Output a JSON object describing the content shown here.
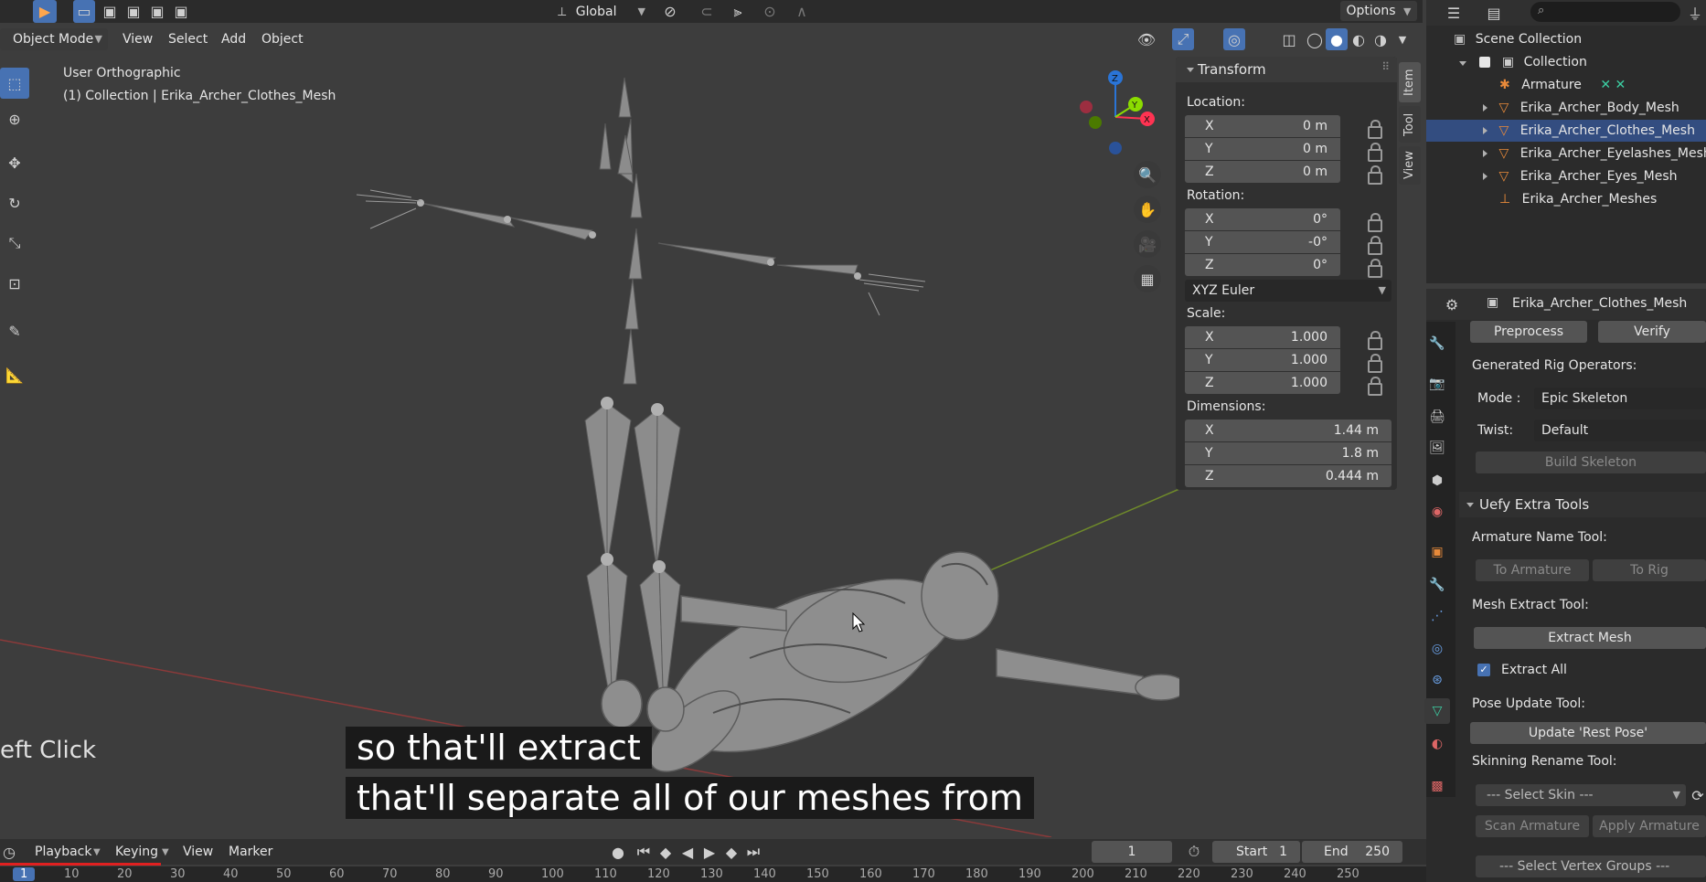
{
  "topbar": {
    "transform_orientation": "Global",
    "options_label": "Options"
  },
  "viewport_header": {
    "mode": "Object Mode",
    "menus": [
      "View",
      "Select",
      "Add",
      "Object"
    ]
  },
  "viewport": {
    "view_name": "User Orthographic",
    "object_info": "(1) Collection | Erika_Archer_Clothes_Mesh",
    "hint_text": "eft Click",
    "gizmo_axes": [
      "Z",
      "Y",
      "X"
    ]
  },
  "transform_panel": {
    "title": "Transform",
    "location_label": "Location:",
    "location": [
      {
        "axis": "X",
        "value": "0 m"
      },
      {
        "axis": "Y",
        "value": "0 m"
      },
      {
        "axis": "Z",
        "value": "0 m"
      }
    ],
    "rotation_label": "Rotation:",
    "rotation": [
      {
        "axis": "X",
        "value": "0°"
      },
      {
        "axis": "Y",
        "value": "-0°"
      },
      {
        "axis": "Z",
        "value": "0°"
      }
    ],
    "rotation_mode": "XYZ Euler",
    "scale_label": "Scale:",
    "scale": [
      {
        "axis": "X",
        "value": "1.000"
      },
      {
        "axis": "Y",
        "value": "1.000"
      },
      {
        "axis": "Z",
        "value": "1.000"
      }
    ],
    "dimensions_label": "Dimensions:",
    "dimensions": [
      {
        "axis": "X",
        "value": "1.44 m"
      },
      {
        "axis": "Y",
        "value": "1.8 m"
      },
      {
        "axis": "Z",
        "value": "0.444 m"
      }
    ]
  },
  "npanel_tabs": [
    "Item",
    "Tool",
    "View"
  ],
  "outliner": {
    "scene_collection": "Scene Collection",
    "collection": "Collection",
    "items": [
      "Armature",
      "Erika_Archer_Body_Mesh",
      "Erika_Archer_Clothes_Mesh",
      "Erika_Archer_Eyelashes_Mesh",
      "Erika_Archer_Eyes_Mesh",
      "Erika_Archer_Meshes"
    ]
  },
  "properties": {
    "object_name": "Erika_Archer_Clothes_Mesh",
    "preprocess_label": "Preprocess",
    "verify_label": "Verify",
    "generated_rig_label": "Generated Rig Operators:",
    "mode_label": "Mode :",
    "mode_value": "Epic Skeleton",
    "twist_label": "Twist:",
    "twist_value": "Default",
    "build_skeleton_label": "Build Skeleton",
    "extra_tools_title": "Uefy Extra Tools",
    "armature_name_tool_label": "Armature Name Tool:",
    "to_armature_label": "To Armature",
    "to_rig_label": "To Rig",
    "mesh_extract_tool_label": "Mesh Extract Tool:",
    "extract_mesh_label": "Extract Mesh",
    "extract_all_label": "Extract All",
    "pose_update_tool_label": "Pose Update Tool:",
    "update_rest_pose_label": "Update 'Rest Pose'",
    "skinning_rename_tool_label": "Skinning Rename Tool:",
    "select_skin_label": "--- Select Skin ---",
    "scan_armature_label": "Scan Armature",
    "apply_armature_label": "Apply Armature",
    "select_vertex_groups_label": "--- Select Vertex Groups ---"
  },
  "timeline": {
    "menus": [
      "Playback",
      "Keying",
      "View",
      "Marker"
    ],
    "current_frame": "1",
    "start_label": "Start",
    "start_value": "1",
    "end_label": "End",
    "end_value": "250",
    "ruler": [
      "1",
      "10",
      "20",
      "30",
      "40",
      "50",
      "60",
      "70",
      "80",
      "90",
      "100",
      "110",
      "120",
      "130",
      "140",
      "150",
      "160",
      "170",
      "180",
      "190",
      "200",
      "210",
      "220",
      "230",
      "240",
      "250"
    ]
  },
  "subtitles": {
    "line1": "so that'll extract",
    "line2": "that'll separate all of our meshes from"
  },
  "colors": {
    "accent_blue": "#4772b3",
    "header": "#303030",
    "viewport_bg": "#3d3d3d",
    "panel_bg": "#303030",
    "field_bg": "#545454"
  }
}
